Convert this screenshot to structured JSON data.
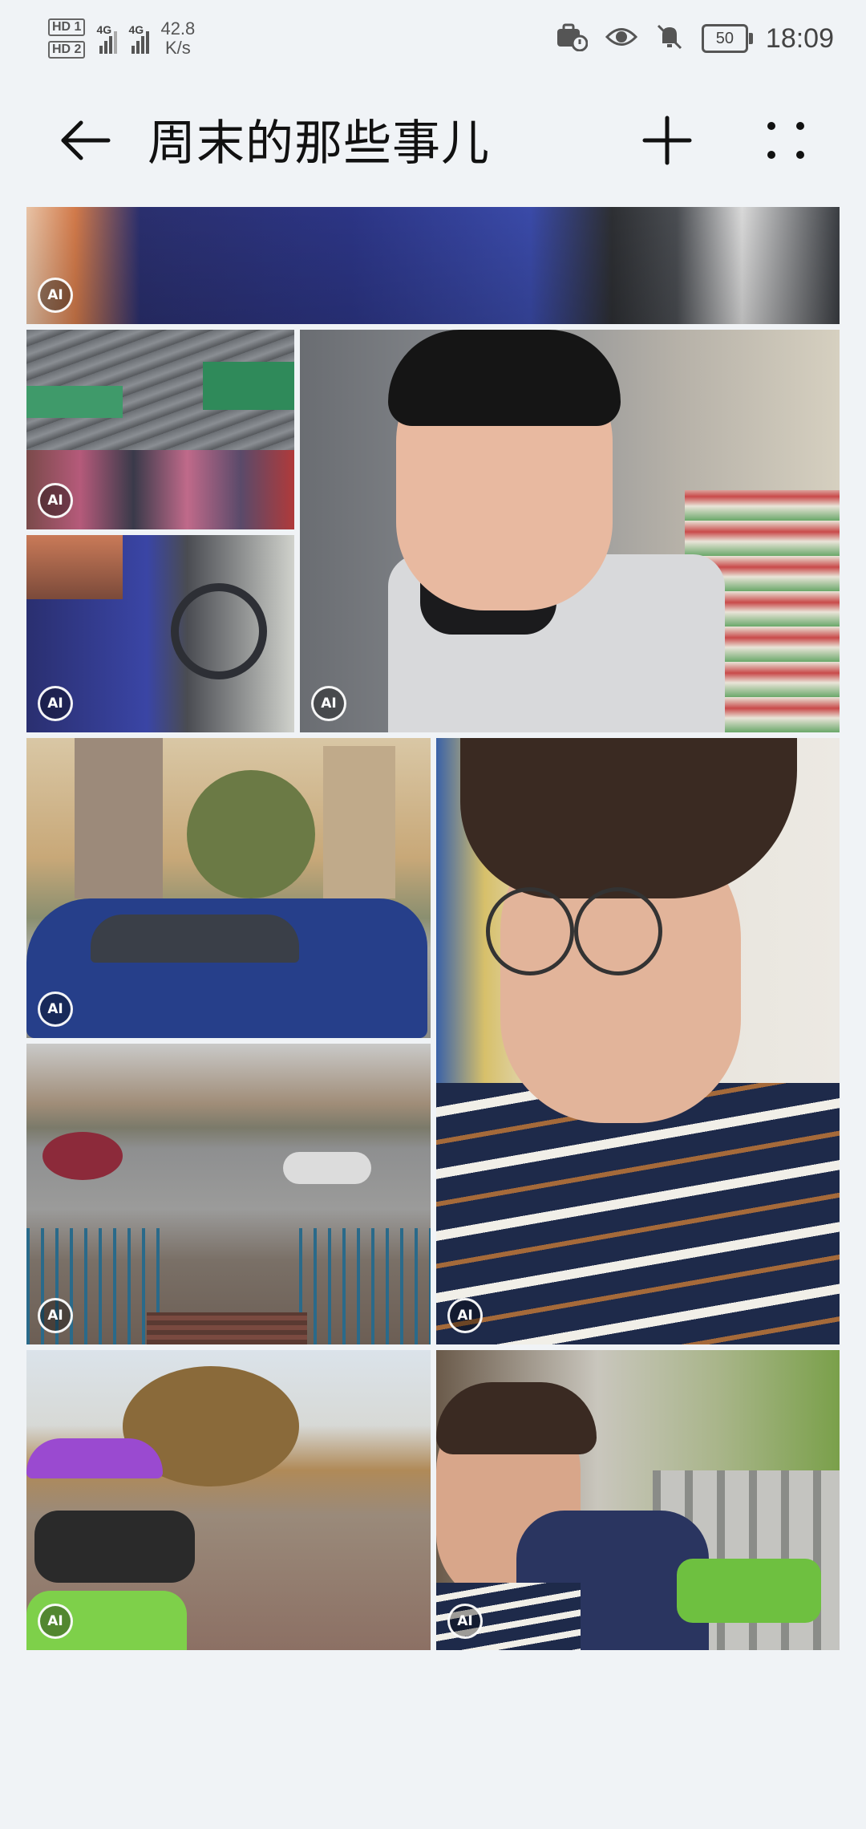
{
  "status_bar": {
    "sim1": "HD 1",
    "sim2": "HD 2",
    "network1": "4G",
    "network2": "4G",
    "speed_value": "42.8",
    "speed_unit": "K/s",
    "battery": "50",
    "time": "18:09",
    "icons": [
      "hd-sim1-icon",
      "hd-sim2-icon",
      "signal-icon",
      "signal-icon",
      "alarm-icon",
      "eye-comfort-icon",
      "mute-icon",
      "battery-icon"
    ]
  },
  "toolbar": {
    "title": "周末的那些事儿",
    "back_icon": "arrow-left-icon",
    "add_icon": "plus-icon",
    "more_icon": "more-dots-icon"
  },
  "photos": [
    {
      "subject": "driver in blue sweater (cropped)",
      "badge": "AI"
    },
    {
      "subject": "covered market with crowd",
      "badge": "AI"
    },
    {
      "subject": "person driving car",
      "badge": "AI"
    },
    {
      "subject": "selfie in produce market",
      "badge": "AI"
    },
    {
      "subject": "blue car by apartment buildings",
      "badge": "AI"
    },
    {
      "subject": "smiling selfie with glasses",
      "badge": "AI"
    },
    {
      "subject": "street view from overpass stairs",
      "badge": "AI"
    },
    {
      "subject": "parked scooters and shared bikes",
      "badge": "AI"
    },
    {
      "subject": "friends on shared bikes",
      "badge": "AI"
    }
  ],
  "colors": {
    "background": "#f0f3f6",
    "text": "#1a1a1a"
  }
}
